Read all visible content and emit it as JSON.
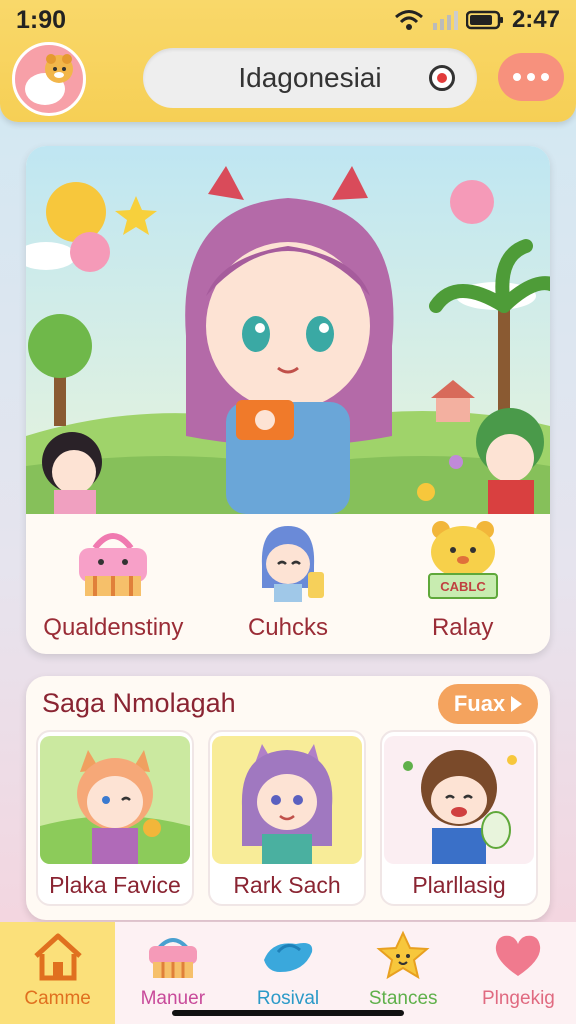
{
  "status": {
    "time_left": "1:90",
    "time_right": "2:47"
  },
  "header": {
    "search_text": "Idagonesiai"
  },
  "hero": {
    "features": [
      {
        "label": "Qualdenstiny",
        "icon": "basket-icon"
      },
      {
        "label": "Cuhcks",
        "icon": "character-icon"
      },
      {
        "label": "Ralay",
        "icon": "bear-sign-icon",
        "sign_text": "CABLC"
      }
    ]
  },
  "saga": {
    "title": "Saga Nmolagah",
    "button_label": "Fuax",
    "cards": [
      {
        "label": "Plaka Favice"
      },
      {
        "label": "Rark Sach"
      },
      {
        "label": "Plarllasig"
      }
    ]
  },
  "nav": {
    "items": [
      {
        "label": "Camme",
        "icon": "home-icon",
        "color": "#e0701f",
        "active": true
      },
      {
        "label": "Manuer",
        "icon": "basket-icon",
        "color": "#c84a9a"
      },
      {
        "label": "Rosival",
        "icon": "bird-icon",
        "color": "#2b9ac8"
      },
      {
        "label": "Stances",
        "icon": "star-icon",
        "color": "#5fb04a"
      },
      {
        "label": "Plngekig",
        "icon": "heart-icon",
        "color": "#e06a80"
      }
    ]
  },
  "colors": {
    "header": "#f7d35e",
    "accent": "#f4a35e",
    "title": "#8a2432"
  }
}
